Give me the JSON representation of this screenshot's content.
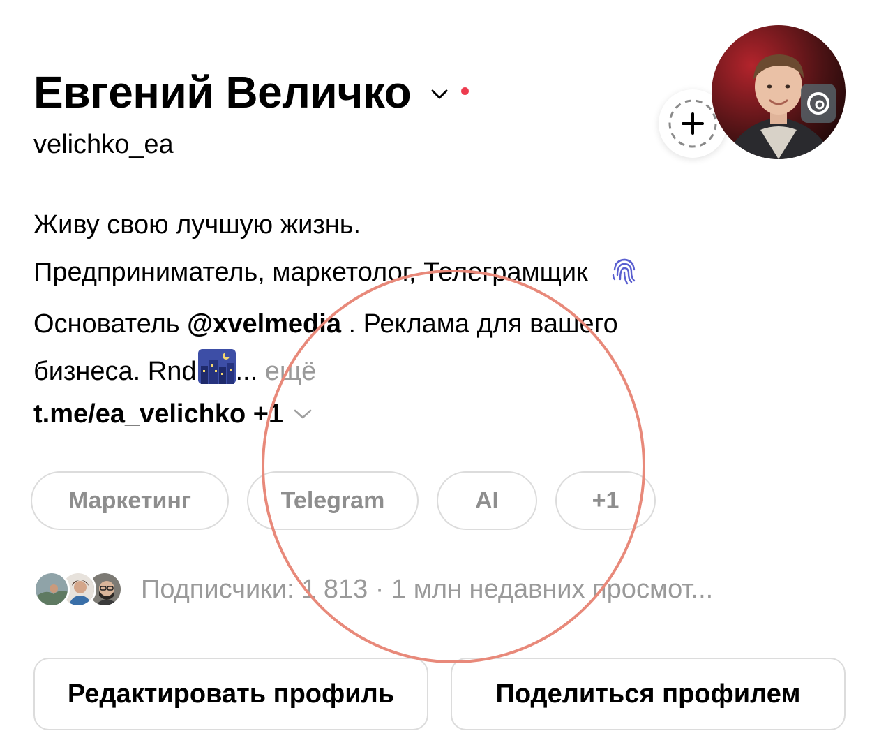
{
  "profile": {
    "name": "Евгений Величко",
    "username": "velichko_ea"
  },
  "bio": {
    "line1": "Живу свою лучшую жизнь.",
    "line2": "Предприниматель, маркетолог, Телеграмщик",
    "line3_prefix": "Основатель ",
    "mention": "@xvelmedia",
    "line3_suffix": " . Реклама для вашего",
    "line4_prefix": "бизнеса. Rnd",
    "ellipsis": "...",
    "more": "ещё"
  },
  "link": {
    "text": "t.me/ea_velichko +1"
  },
  "tags": [
    "Маркетинг",
    "Telegram",
    "AI",
    "+1"
  ],
  "followers": {
    "text": "Подписчики: 1 813 · 1 млн недавних просмот..."
  },
  "buttons": {
    "edit": "Редактировать профиль",
    "share": "Поделиться профилем"
  },
  "colors": {
    "accent_red_dot": "#ed3b4e",
    "annotation_circle": "#e8897a",
    "muted_text": "#9a9a9a",
    "border": "#dcdcdc"
  },
  "icons": {
    "name_chevron": "chevron-down-icon",
    "status_dot": "red-dot-icon",
    "add_note": "plus-icon",
    "threads_badge": "threads-icon",
    "fingerprint_emoji": "fingerprint-icon",
    "city_night_emoji": "night-city-icon",
    "link_chevron": "chevron-down-icon"
  }
}
